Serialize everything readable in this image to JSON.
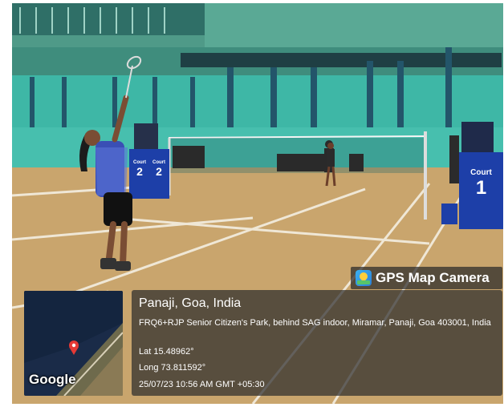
{
  "scene": {
    "description_colors": {
      "wall": "#3eb7a6",
      "floor": "#c9a56d",
      "roof": "#5ea392",
      "court_sign": "#1d3fa8"
    }
  },
  "court_signs": [
    {
      "label": "Court",
      "number": "2"
    },
    {
      "label": "Court",
      "number": "2"
    },
    {
      "label": "Court",
      "number": "1"
    }
  ],
  "overlay": {
    "app_name": "GPS Map Camera",
    "location_title": "Panaji, Goa, India",
    "address": "FRQ6+RJP Senior Citizen's Park, behind SAG indoor, Miramar, Panaji, Goa 403001, India",
    "lat": "Lat 15.48962°",
    "long": "Long 73.811592°",
    "datetime": "25/07/23 10:56 AM GMT +05:30",
    "map_brand": "Google"
  }
}
